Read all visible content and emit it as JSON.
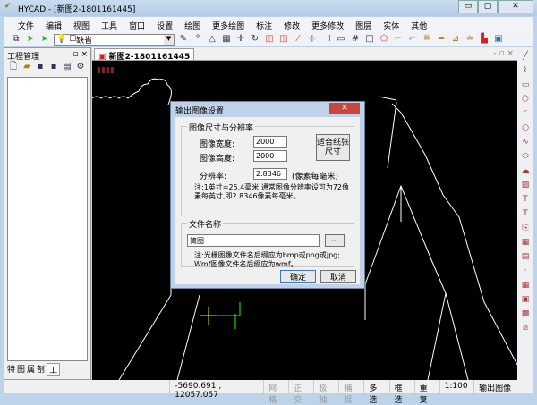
{
  "window": {
    "title": "HYCAD - [新图2-1801161445]",
    "minimize": "▭",
    "maximize": "▢",
    "close": "✕"
  },
  "menu": [
    "文件",
    "编辑",
    "视图",
    "工具",
    "窗口",
    "设置",
    "绘图",
    "更多绘图",
    "标注",
    "修改",
    "更多修改",
    "图层",
    "实体",
    "其他"
  ],
  "toolbar": {
    "layer_value": "缺省"
  },
  "panel": {
    "title": "工程管理",
    "controls": "▫ ×",
    "tabs": [
      "特",
      "图",
      "属",
      "剖",
      "工"
    ]
  },
  "document": {
    "tab": "新图2-1801161445",
    "controls": "- ▫ ×"
  },
  "dialog": {
    "title": "输出图像设置",
    "close": "✕",
    "group_size": "图像尺寸与分辨率",
    "width_label": "图像宽度:",
    "width_value": "2000",
    "height_label": "图像高度:",
    "height_value": "2000",
    "fit_button": "适合纸张尺寸",
    "resolution_label": "分辨率:",
    "resolution_value": "2.8346",
    "resolution_unit": "(像素每毫米)",
    "resolution_note": "注:1英寸=25.4毫米,通常图像分辨率设可为72像素每英寸,即2.8346像素每毫米。",
    "group_file": "文件名称",
    "file_value": "简图",
    "browse": "...",
    "file_note": "注:光栅图像文件名后缀应为bmp或png或jpg; Wmf图像文件名后缀应为wmf。",
    "ok": "确定",
    "cancel": "取消"
  },
  "status": {
    "coords": "-5690.691 , 12057.057",
    "items": [
      {
        "label": "网格",
        "on": false
      },
      {
        "label": "正交",
        "on": false
      },
      {
        "label": "极轴",
        "on": false
      },
      {
        "label": "捕捉",
        "on": false
      },
      {
        "label": "多选",
        "on": true
      },
      {
        "label": "框选",
        "on": true
      },
      {
        "label": "重复",
        "on": true
      }
    ],
    "scale": "1:100",
    "command": "输出图像"
  }
}
